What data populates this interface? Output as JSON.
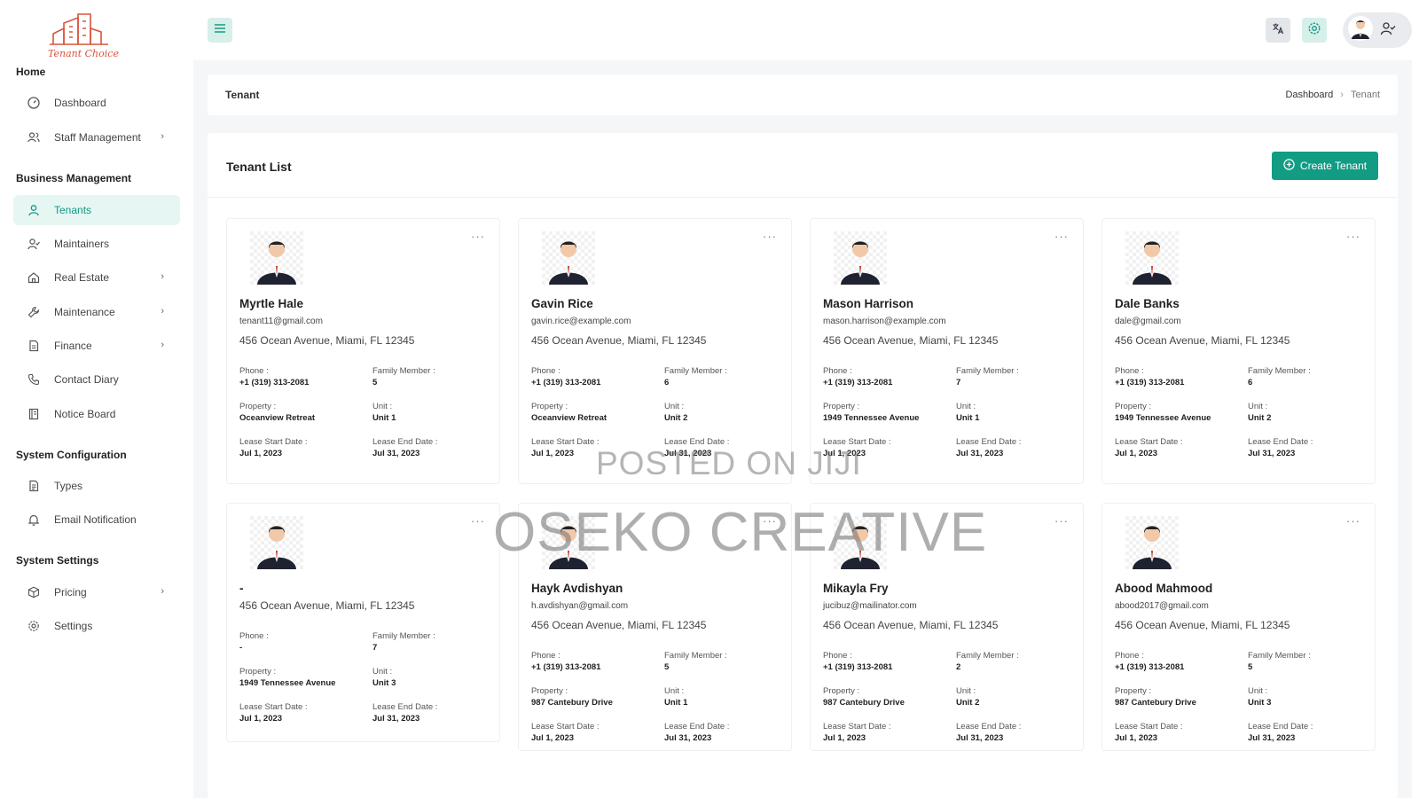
{
  "brand": {
    "logo_text": "Tenant Choice"
  },
  "sidebar": {
    "sections": [
      {
        "title": "Home"
      },
      {
        "title": "Business Management"
      },
      {
        "title": "System Configuration"
      },
      {
        "title": "System Settings"
      }
    ],
    "items": [
      {
        "label": "Dashboard",
        "icon": "dashboard-icon"
      },
      {
        "label": "Staff Management",
        "icon": "users-icon",
        "has_submenu": true
      },
      {
        "label": "Tenants",
        "icon": "user-icon",
        "active": true
      },
      {
        "label": "Maintainers",
        "icon": "user-check-icon"
      },
      {
        "label": "Real Estate",
        "icon": "home-icon",
        "has_submenu": true
      },
      {
        "label": "Maintenance",
        "icon": "wrench-icon",
        "has_submenu": true
      },
      {
        "label": "Finance",
        "icon": "file-icon",
        "has_submenu": true
      },
      {
        "label": "Contact Diary",
        "icon": "phone-icon"
      },
      {
        "label": "Notice Board",
        "icon": "notebook-icon"
      },
      {
        "label": "Types",
        "icon": "document-icon"
      },
      {
        "label": "Email Notification",
        "icon": "bell-icon"
      },
      {
        "label": "Pricing",
        "icon": "box-icon",
        "has_submenu": true
      },
      {
        "label": "Settings",
        "icon": "gear-icon"
      }
    ]
  },
  "header": {
    "icons": [
      "menu-icon",
      "translate-icon",
      "settings-icon",
      "avatar",
      "user-check-icon"
    ]
  },
  "breadcrumb": {
    "title": "Tenant",
    "path": [
      "Dashboard",
      "Tenant"
    ]
  },
  "tenant_list": {
    "title": "Tenant List",
    "create_label": "Create Tenant",
    "labels": {
      "phone": "Phone :",
      "family": "Family Member :",
      "property": "Property :",
      "unit": "Unit :",
      "lease_start": "Lease Start Date :",
      "lease_end": "Lease End Date :"
    },
    "tenants": [
      {
        "name": "Myrtle Hale",
        "email": "tenant11@gmail.com",
        "address": "456 Ocean Avenue, Miami, FL 12345",
        "phone": "+1 (319) 313-2081",
        "family": "5",
        "property": "Oceanview Retreat",
        "unit": "Unit 1",
        "lease_start": "Jul 1, 2023",
        "lease_end": "Jul 31, 2023"
      },
      {
        "name": "Gavin Rice",
        "email": "gavin.rice@example.com",
        "address": "456 Ocean Avenue, Miami, FL 12345",
        "phone": "+1 (319) 313-2081",
        "family": "6",
        "property": "Oceanview Retreat",
        "unit": "Unit 2",
        "lease_start": "Jul 1, 2023",
        "lease_end": "Jul 31, 2023"
      },
      {
        "name": "Mason Harrison",
        "email": "mason.harrison@example.com",
        "address": "456 Ocean Avenue, Miami, FL 12345",
        "phone": "+1 (319) 313-2081",
        "family": "7",
        "property": "1949 Tennessee Avenue",
        "unit": "Unit 1",
        "lease_start": "Jul 1, 2023",
        "lease_end": "Jul 31, 2023"
      },
      {
        "name": "Dale Banks",
        "email": "dale@gmail.com",
        "address": "456 Ocean Avenue, Miami, FL 12345",
        "phone": "+1 (319) 313-2081",
        "family": "6",
        "property": "1949 Tennessee Avenue",
        "unit": "Unit 2",
        "lease_start": "Jul 1, 2023",
        "lease_end": "Jul 31, 2023"
      },
      {
        "name": "-",
        "email": "",
        "address": "456 Ocean Avenue, Miami, FL 12345",
        "phone": "-",
        "family": "7",
        "property": "1949 Tennessee Avenue",
        "unit": "Unit 3",
        "lease_start": "Jul 1, 2023",
        "lease_end": "Jul 31, 2023"
      },
      {
        "name": "Hayk Avdishyan",
        "email": "h.avdishyan@gmail.com",
        "address": "456 Ocean Avenue, Miami, FL 12345",
        "phone": "+1 (319) 313-2081",
        "family": "5",
        "property": "987 Cantebury Drive",
        "unit": "Unit 1",
        "lease_start": "Jul 1, 2023",
        "lease_end": "Jul 31, 2023"
      },
      {
        "name": "Mikayla Fry",
        "email": "jucibuz@mailinator.com",
        "address": "456 Ocean Avenue, Miami, FL 12345",
        "phone": "+1 (319) 313-2081",
        "family": "2",
        "property": "987 Cantebury Drive",
        "unit": "Unit 2",
        "lease_start": "Jul 1, 2023",
        "lease_end": "Jul 31, 2023"
      },
      {
        "name": "Abood Mahmood",
        "email": "abood2017@gmail.com",
        "address": "456 Ocean Avenue, Miami, FL 12345",
        "phone": "+1 (319) 313-2081",
        "family": "5",
        "property": "987 Cantebury Drive",
        "unit": "Unit 3",
        "lease_start": "Jul 1, 2023",
        "lease_end": "Jul 31, 2023"
      }
    ]
  },
  "watermark": {
    "line1": "POSTED ON JIJI",
    "line2": "OSEKO CREATIVE"
  },
  "colors": {
    "accent": "#129c84",
    "active_bg": "#e6f6f3",
    "content_bg": "#f4f6f8"
  }
}
